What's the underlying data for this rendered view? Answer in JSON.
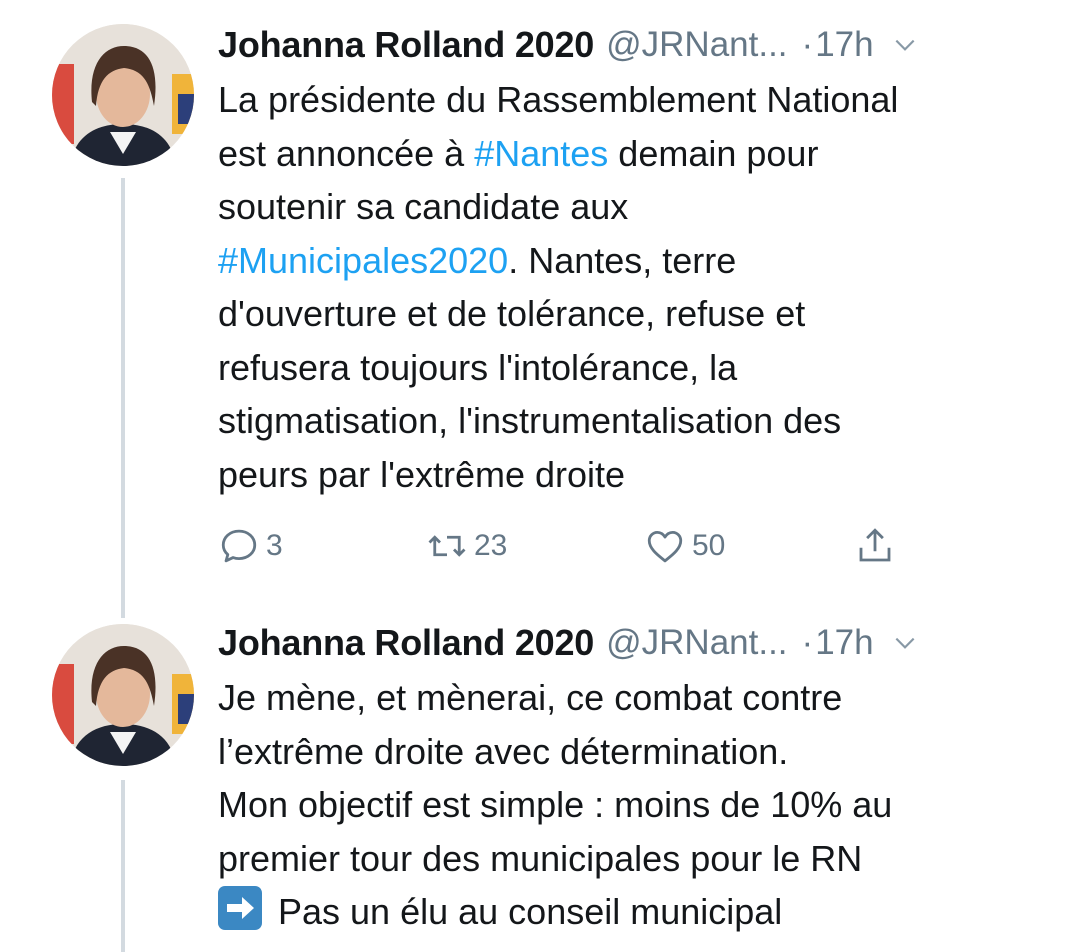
{
  "tweets": [
    {
      "author_name": "Johanna Rolland 2020",
      "handle": "@JRNant...",
      "dot": "·",
      "time": "17h",
      "lines": [
        {
          "pre": "La présidente du Rassemblement National",
          "tag": "",
          "post": ""
        },
        {
          "pre": "est annoncée à ",
          "tag": "#Nantes",
          "post": " demain pour"
        },
        {
          "pre": "soutenir sa candidate aux",
          "tag": "",
          "post": ""
        },
        {
          "pre": "",
          "tag": "#Municipales2020",
          "post": ". Nantes, terre"
        },
        {
          "pre": "d'ouverture et de tolérance, refuse et",
          "tag": "",
          "post": ""
        },
        {
          "pre": "refusera toujours l'intolérance, la",
          "tag": "",
          "post": ""
        },
        {
          "pre": "stigmatisation, l'instrumentalisation des",
          "tag": "",
          "post": ""
        },
        {
          "pre": "peurs par l'extrême droite",
          "tag": "",
          "post": ""
        }
      ],
      "replies": "3",
      "retweets": "23",
      "likes": "50"
    },
    {
      "author_name": "Johanna Rolland 2020",
      "handle": "@JRNant...",
      "dot": "·",
      "time": "17h",
      "lines": [
        {
          "pre": "Je mène, et mènerai, ce combat contre"
        },
        {
          "pre": "l’extrême droite avec détermination."
        },
        {
          "pre": "Mon objectif est simple : moins de 10% au"
        },
        {
          "pre": "premier tour des municipales pour le RN"
        },
        {
          "pre": "Pas un élu au conseil municipal"
        }
      ]
    }
  ],
  "icons": {
    "reply": "reply-icon",
    "retweet": "retweet-icon",
    "like": "heart-icon",
    "share": "share-icon",
    "caret": "chevron-down-icon",
    "arrow": "right-arrow-emoji"
  },
  "colors": {
    "text": "#14171a",
    "secondary": "#657786",
    "link": "#1da1f2",
    "thread_line": "#d3dae0"
  }
}
